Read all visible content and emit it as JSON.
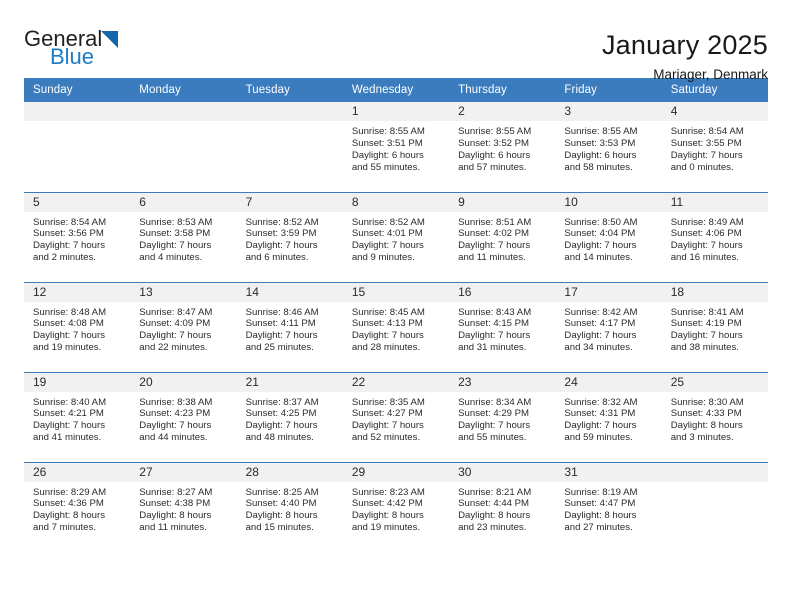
{
  "brand": {
    "name_part1": "General",
    "name_part2": "Blue",
    "triangle_color": "#1565ad",
    "blue_text_color": "#1c7cc4"
  },
  "header": {
    "title": "January 2025",
    "location": "Mariager, Denmark"
  },
  "theme": {
    "header_blue": "#3b7cbe",
    "daynum_gray": "#f1f1f1",
    "text": "#2b2b2b"
  },
  "weekday_headers": [
    "Sunday",
    "Monday",
    "Tuesday",
    "Wednesday",
    "Thursday",
    "Friday",
    "Saturday"
  ],
  "weeks": [
    [
      {
        "day": "",
        "blank": true,
        "sunrise": "",
        "sunset": "",
        "daylight1": "",
        "daylight2": ""
      },
      {
        "day": "",
        "blank": true,
        "sunrise": "",
        "sunset": "",
        "daylight1": "",
        "daylight2": ""
      },
      {
        "day": "",
        "blank": true,
        "sunrise": "",
        "sunset": "",
        "daylight1": "",
        "daylight2": ""
      },
      {
        "day": "1",
        "blank": false,
        "sunrise": "Sunrise: 8:55 AM",
        "sunset": "Sunset: 3:51 PM",
        "daylight1": "Daylight: 6 hours",
        "daylight2": "and 55 minutes."
      },
      {
        "day": "2",
        "blank": false,
        "sunrise": "Sunrise: 8:55 AM",
        "sunset": "Sunset: 3:52 PM",
        "daylight1": "Daylight: 6 hours",
        "daylight2": "and 57 minutes."
      },
      {
        "day": "3",
        "blank": false,
        "sunrise": "Sunrise: 8:55 AM",
        "sunset": "Sunset: 3:53 PM",
        "daylight1": "Daylight: 6 hours",
        "daylight2": "and 58 minutes."
      },
      {
        "day": "4",
        "blank": false,
        "sunrise": "Sunrise: 8:54 AM",
        "sunset": "Sunset: 3:55 PM",
        "daylight1": "Daylight: 7 hours",
        "daylight2": "and 0 minutes."
      }
    ],
    [
      {
        "day": "5",
        "blank": false,
        "sunrise": "Sunrise: 8:54 AM",
        "sunset": "Sunset: 3:56 PM",
        "daylight1": "Daylight: 7 hours",
        "daylight2": "and 2 minutes."
      },
      {
        "day": "6",
        "blank": false,
        "sunrise": "Sunrise: 8:53 AM",
        "sunset": "Sunset: 3:58 PM",
        "daylight1": "Daylight: 7 hours",
        "daylight2": "and 4 minutes."
      },
      {
        "day": "7",
        "blank": false,
        "sunrise": "Sunrise: 8:52 AM",
        "sunset": "Sunset: 3:59 PM",
        "daylight1": "Daylight: 7 hours",
        "daylight2": "and 6 minutes."
      },
      {
        "day": "8",
        "blank": false,
        "sunrise": "Sunrise: 8:52 AM",
        "sunset": "Sunset: 4:01 PM",
        "daylight1": "Daylight: 7 hours",
        "daylight2": "and 9 minutes."
      },
      {
        "day": "9",
        "blank": false,
        "sunrise": "Sunrise: 8:51 AM",
        "sunset": "Sunset: 4:02 PM",
        "daylight1": "Daylight: 7 hours",
        "daylight2": "and 11 minutes."
      },
      {
        "day": "10",
        "blank": false,
        "sunrise": "Sunrise: 8:50 AM",
        "sunset": "Sunset: 4:04 PM",
        "daylight1": "Daylight: 7 hours",
        "daylight2": "and 14 minutes."
      },
      {
        "day": "11",
        "blank": false,
        "sunrise": "Sunrise: 8:49 AM",
        "sunset": "Sunset: 4:06 PM",
        "daylight1": "Daylight: 7 hours",
        "daylight2": "and 16 minutes."
      }
    ],
    [
      {
        "day": "12",
        "blank": false,
        "sunrise": "Sunrise: 8:48 AM",
        "sunset": "Sunset: 4:08 PM",
        "daylight1": "Daylight: 7 hours",
        "daylight2": "and 19 minutes."
      },
      {
        "day": "13",
        "blank": false,
        "sunrise": "Sunrise: 8:47 AM",
        "sunset": "Sunset: 4:09 PM",
        "daylight1": "Daylight: 7 hours",
        "daylight2": "and 22 minutes."
      },
      {
        "day": "14",
        "blank": false,
        "sunrise": "Sunrise: 8:46 AM",
        "sunset": "Sunset: 4:11 PM",
        "daylight1": "Daylight: 7 hours",
        "daylight2": "and 25 minutes."
      },
      {
        "day": "15",
        "blank": false,
        "sunrise": "Sunrise: 8:45 AM",
        "sunset": "Sunset: 4:13 PM",
        "daylight1": "Daylight: 7 hours",
        "daylight2": "and 28 minutes."
      },
      {
        "day": "16",
        "blank": false,
        "sunrise": "Sunrise: 8:43 AM",
        "sunset": "Sunset: 4:15 PM",
        "daylight1": "Daylight: 7 hours",
        "daylight2": "and 31 minutes."
      },
      {
        "day": "17",
        "blank": false,
        "sunrise": "Sunrise: 8:42 AM",
        "sunset": "Sunset: 4:17 PM",
        "daylight1": "Daylight: 7 hours",
        "daylight2": "and 34 minutes."
      },
      {
        "day": "18",
        "blank": false,
        "sunrise": "Sunrise: 8:41 AM",
        "sunset": "Sunset: 4:19 PM",
        "daylight1": "Daylight: 7 hours",
        "daylight2": "and 38 minutes."
      }
    ],
    [
      {
        "day": "19",
        "blank": false,
        "sunrise": "Sunrise: 8:40 AM",
        "sunset": "Sunset: 4:21 PM",
        "daylight1": "Daylight: 7 hours",
        "daylight2": "and 41 minutes."
      },
      {
        "day": "20",
        "blank": false,
        "sunrise": "Sunrise: 8:38 AM",
        "sunset": "Sunset: 4:23 PM",
        "daylight1": "Daylight: 7 hours",
        "daylight2": "and 44 minutes."
      },
      {
        "day": "21",
        "blank": false,
        "sunrise": "Sunrise: 8:37 AM",
        "sunset": "Sunset: 4:25 PM",
        "daylight1": "Daylight: 7 hours",
        "daylight2": "and 48 minutes."
      },
      {
        "day": "22",
        "blank": false,
        "sunrise": "Sunrise: 8:35 AM",
        "sunset": "Sunset: 4:27 PM",
        "daylight1": "Daylight: 7 hours",
        "daylight2": "and 52 minutes."
      },
      {
        "day": "23",
        "blank": false,
        "sunrise": "Sunrise: 8:34 AM",
        "sunset": "Sunset: 4:29 PM",
        "daylight1": "Daylight: 7 hours",
        "daylight2": "and 55 minutes."
      },
      {
        "day": "24",
        "blank": false,
        "sunrise": "Sunrise: 8:32 AM",
        "sunset": "Sunset: 4:31 PM",
        "daylight1": "Daylight: 7 hours",
        "daylight2": "and 59 minutes."
      },
      {
        "day": "25",
        "blank": false,
        "sunrise": "Sunrise: 8:30 AM",
        "sunset": "Sunset: 4:33 PM",
        "daylight1": "Daylight: 8 hours",
        "daylight2": "and 3 minutes."
      }
    ],
    [
      {
        "day": "26",
        "blank": false,
        "sunrise": "Sunrise: 8:29 AM",
        "sunset": "Sunset: 4:36 PM",
        "daylight1": "Daylight: 8 hours",
        "daylight2": "and 7 minutes."
      },
      {
        "day": "27",
        "blank": false,
        "sunrise": "Sunrise: 8:27 AM",
        "sunset": "Sunset: 4:38 PM",
        "daylight1": "Daylight: 8 hours",
        "daylight2": "and 11 minutes."
      },
      {
        "day": "28",
        "blank": false,
        "sunrise": "Sunrise: 8:25 AM",
        "sunset": "Sunset: 4:40 PM",
        "daylight1": "Daylight: 8 hours",
        "daylight2": "and 15 minutes."
      },
      {
        "day": "29",
        "blank": false,
        "sunrise": "Sunrise: 8:23 AM",
        "sunset": "Sunset: 4:42 PM",
        "daylight1": "Daylight: 8 hours",
        "daylight2": "and 19 minutes."
      },
      {
        "day": "30",
        "blank": false,
        "sunrise": "Sunrise: 8:21 AM",
        "sunset": "Sunset: 4:44 PM",
        "daylight1": "Daylight: 8 hours",
        "daylight2": "and 23 minutes."
      },
      {
        "day": "31",
        "blank": false,
        "sunrise": "Sunrise: 8:19 AM",
        "sunset": "Sunset: 4:47 PM",
        "daylight1": "Daylight: 8 hours",
        "daylight2": "and 27 minutes."
      },
      {
        "day": "",
        "blank": true,
        "sunrise": "",
        "sunset": "",
        "daylight1": "",
        "daylight2": ""
      }
    ]
  ]
}
